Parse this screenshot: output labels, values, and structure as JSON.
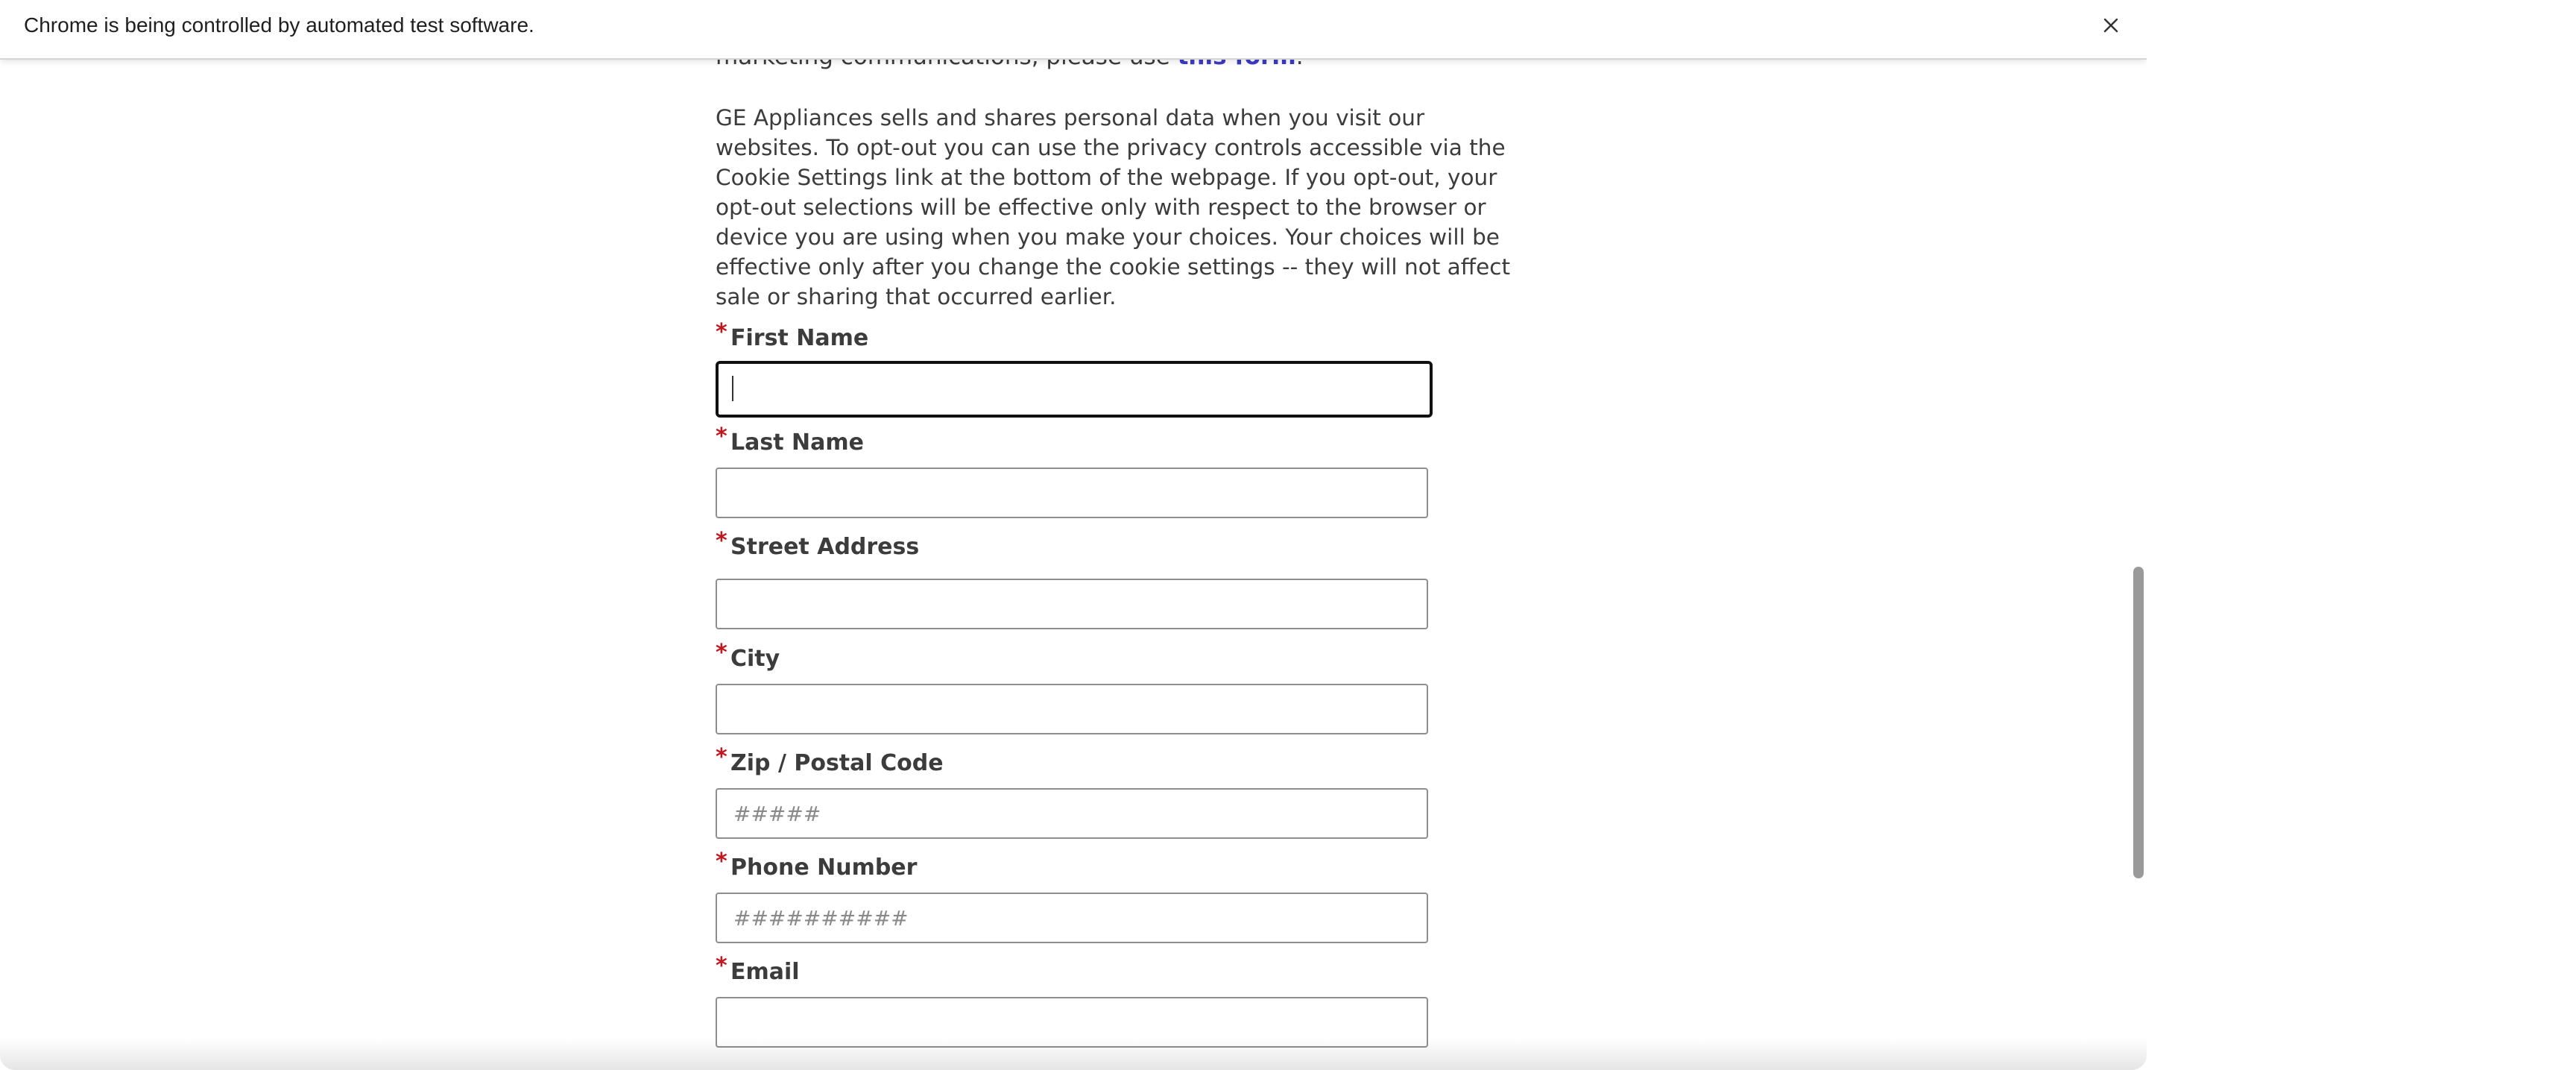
{
  "infobar": {
    "message": "Chrome is being controlled by automated test software.",
    "close_icon": "close-icon"
  },
  "intro": {
    "text_before_link": "marketing communications, please use ",
    "link_text": "this form",
    "text_after_link": "."
  },
  "paragraph_lines": [
    "GE Appliances sells and shares personal data when you visit our",
    "websites. To opt-out you can use the privacy controls accessible via the",
    "Cookie Settings link at the bottom of the webpage. If you opt-out, your",
    "opt-out selections will be effective only with respect to the browser or",
    "device you are using when you make your choices. Your choices will be",
    "effective only after you change the cookie settings -- they will not affect",
    "sale or sharing that occurred earlier."
  ],
  "form": {
    "required_marker": "*",
    "fields": [
      {
        "label": "First Name",
        "value": "",
        "placeholder": ""
      },
      {
        "label": "Last Name",
        "value": "",
        "placeholder": ""
      },
      {
        "label": "Street Address",
        "value": "",
        "placeholder": ""
      },
      {
        "label": "City",
        "value": "",
        "placeholder": ""
      },
      {
        "label": "Zip / Postal Code",
        "value": "",
        "placeholder": "#####"
      },
      {
        "label": "Phone Number",
        "value": "",
        "placeholder": "##########"
      },
      {
        "label": "Email",
        "value": "",
        "placeholder": ""
      }
    ]
  },
  "colors": {
    "link": "#3b3bc4",
    "required": "#c4161c",
    "text": "#3c3c3c"
  }
}
